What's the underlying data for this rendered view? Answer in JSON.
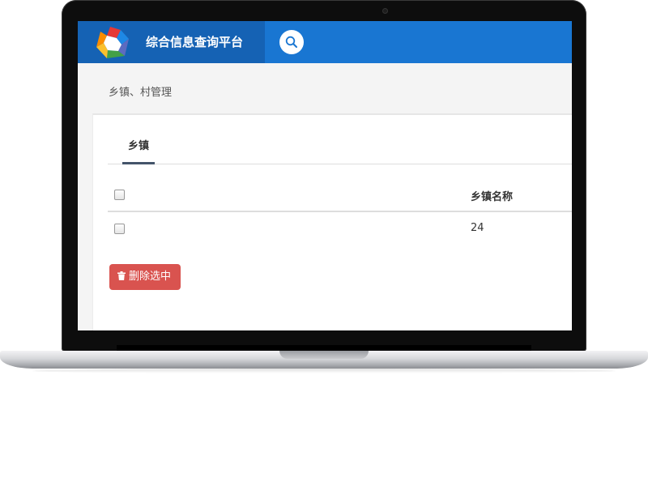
{
  "header": {
    "app_title": "综合信息查询平台",
    "logo_icon": "colorful-pentagon-logo-icon",
    "search_icon": "search-icon",
    "colors": {
      "topbar": "#1976d2",
      "brand_bg": "#1562b4"
    }
  },
  "breadcrumb": {
    "text": "乡镇、村管理"
  },
  "tabs": [
    {
      "label": "乡镇",
      "active": true
    }
  ],
  "table": {
    "columns": [
      "",
      "乡镇名称"
    ],
    "rows": [
      {
        "checked": false,
        "name": "24"
      }
    ]
  },
  "actions": {
    "delete_label": "删除选中",
    "delete_icon": "trash-icon",
    "delete_color": "#d9534f"
  }
}
